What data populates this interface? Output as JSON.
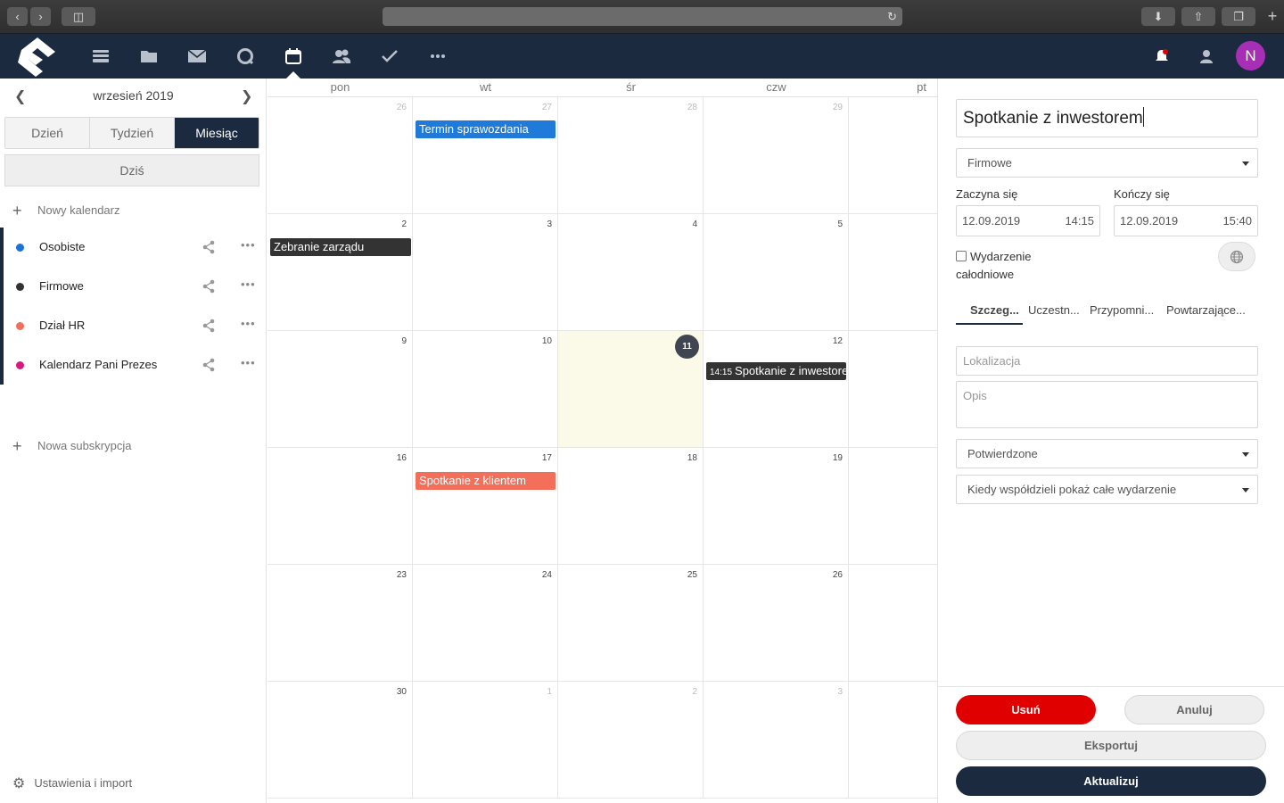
{
  "appbar": {
    "avatar_initial": "N",
    "accent": "#1c2a40"
  },
  "sidebar": {
    "month_label": "wrzesień 2019",
    "views": [
      "Dzień",
      "Tydzień",
      "Miesiąc"
    ],
    "active_view": "Miesiąc",
    "today_label": "Dziś",
    "new_calendar_label": "Nowy kalendarz",
    "calendars": [
      {
        "name": "Osobiste",
        "color": "#1a73d6"
      },
      {
        "name": "Firmowe",
        "color": "#333333"
      },
      {
        "name": "Dział HR",
        "color": "#f36f5a"
      },
      {
        "name": "Kalendarz Pani Prezes",
        "color": "#d6197e"
      }
    ],
    "new_subscription_label": "Nowa subskrypcja",
    "settings_label": "Ustawienia i import"
  },
  "calendar": {
    "weekdays": [
      "pon",
      "wt",
      "śr",
      "czw",
      "pt"
    ],
    "weeks": [
      [
        "26",
        "27",
        "28",
        "29",
        ""
      ],
      [
        "2",
        "3",
        "4",
        "5",
        ""
      ],
      [
        "9",
        "10",
        "11",
        "12",
        ""
      ],
      [
        "16",
        "17",
        "18",
        "19",
        ""
      ],
      [
        "23",
        "24",
        "25",
        "26",
        ""
      ],
      [
        "30",
        "1",
        "2",
        "3",
        ""
      ]
    ],
    "today": "11",
    "events": {
      "termin": {
        "title": "Termin sprawozdania",
        "color": "#1f7ad9"
      },
      "zebranie": {
        "title": "Zebranie zarządu",
        "color": "#333333"
      },
      "spotkanie_inw": {
        "time": "14:15",
        "title": "Spotkanie z inwestorem",
        "color": "#333333"
      },
      "spotkanie_kl": {
        "title": "Spotkanie z klientem",
        "color": "#f36f5a"
      }
    }
  },
  "event_panel": {
    "title": "Spotkanie z inwestorem",
    "calendar_select": "Firmowe",
    "start_label": "Zaczyna się",
    "end_label": "Kończy się",
    "start_date": "12.09.2019",
    "start_time": "14:15",
    "end_date": "12.09.2019",
    "end_time": "15:40",
    "all_day_line1": "Wydarzenie",
    "all_day_line2": "całodniowe",
    "tabs": [
      "Szczeg...",
      "Uczestn...",
      "Przypomni...",
      "Powtarzające..."
    ],
    "location_placeholder": "Lokalizacja",
    "description_placeholder": "Opis",
    "status_select": "Potwierdzone",
    "sharing_select": "Kiedy współdzieli pokaż całe wydarzenie",
    "delete_label": "Usuń",
    "cancel_label": "Anuluj",
    "export_label": "Eksportuj",
    "update_label": "Aktualizuj"
  }
}
